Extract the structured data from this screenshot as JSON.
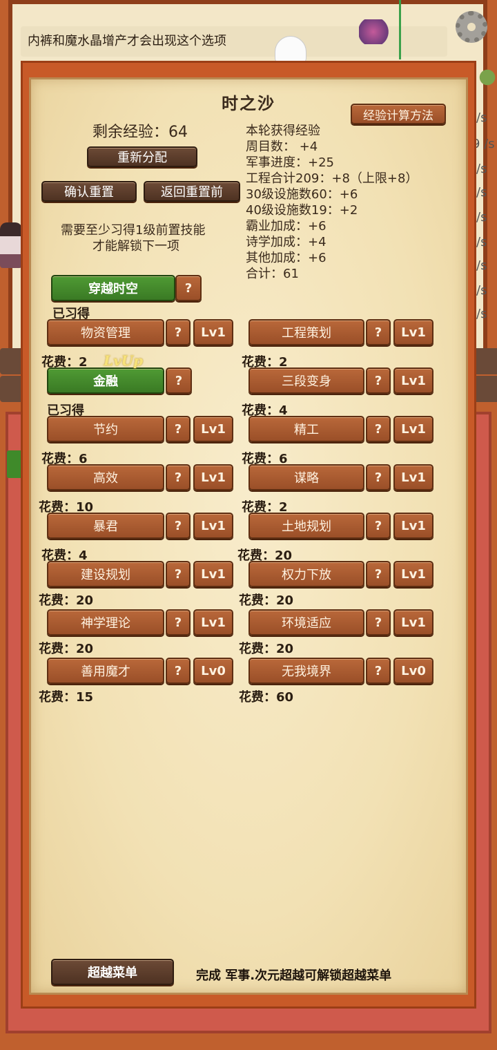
{
  "background": {
    "notice_text": "内裤和魔水晶增产才会出现这个选项",
    "side_text": [
      "/s",
      "/s",
      "9 /s",
      "/s",
      "/s",
      "/s",
      "/s",
      "/s",
      "/s",
      "/s"
    ]
  },
  "dialog": {
    "title": "时之沙",
    "exp_calc_button": "经验计算方法",
    "remaining_exp": "剩余经验：64",
    "reallocate_button": "重新分配",
    "confirm_reset_button": "确认重置",
    "revert_reset_button": "返回重置前",
    "prereq_note_line1": "需要至少习得1级前置技能",
    "prereq_note_line2": "才能解锁下一项",
    "exp_breakdown": [
      "本轮获得经验",
      "周目数： +4",
      "军事进度：+25",
      "工程合计209：+8（上限+8）",
      "30级设施数60：+6",
      "40级设施数19：+2",
      "霸业加成：+6",
      "诗学加成：+4",
      "其他加成：+6",
      "合计：61"
    ],
    "lvup_text": "LvUp",
    "skills": [
      {
        "name": "穿越时空",
        "help": "?",
        "learned": true,
        "status": "已习得"
      },
      {
        "name": "物资管理",
        "help": "?",
        "level": "Lv1",
        "cost": "花费：2"
      },
      {
        "name": "工程策划",
        "help": "?",
        "level": "Lv1",
        "cost": "花费：2"
      },
      {
        "name": "金融",
        "help": "?",
        "learned": true,
        "status": "已习得"
      },
      {
        "name": "三段变身",
        "help": "?",
        "level": "Lv1",
        "cost": "花费：4"
      },
      {
        "name": "节约",
        "help": "?",
        "level": "Lv1",
        "cost": "花费：6"
      },
      {
        "name": "精工",
        "help": "?",
        "level": "Lv1",
        "cost": "花费：6"
      },
      {
        "name": "高效",
        "help": "?",
        "level": "Lv1",
        "cost": "花费：10"
      },
      {
        "name": "谋略",
        "help": "?",
        "level": "Lv1",
        "cost": "花费：2"
      },
      {
        "name": "暴君",
        "help": "?",
        "level": "Lv1",
        "cost": "花费：4"
      },
      {
        "name": "土地规划",
        "help": "?",
        "level": "Lv1",
        "cost": "花费：20"
      },
      {
        "name": "建设规划",
        "help": "?",
        "level": "Lv1",
        "cost": "花费：20"
      },
      {
        "name": "权力下放",
        "help": "?",
        "level": "Lv1",
        "cost": "花费：20"
      },
      {
        "name": "神学理论",
        "help": "?",
        "level": "Lv1",
        "cost": "花费：20"
      },
      {
        "name": "环境适应",
        "help": "?",
        "level": "Lv1",
        "cost": "花费：20"
      },
      {
        "name": "善用魔才",
        "help": "?",
        "level": "Lv0",
        "cost": "花费：15"
      },
      {
        "name": "无我境界",
        "help": "?",
        "level": "Lv0",
        "cost": "花费：60"
      }
    ],
    "super_menu_button": "超越菜单",
    "bottom_note": "完成 军事.次元超越可解锁超越菜单"
  },
  "colors": {
    "wood": "#a85a30",
    "green": "#3f8a2a",
    "parchment": "#f2e1b4",
    "frame": "#c85a28"
  }
}
